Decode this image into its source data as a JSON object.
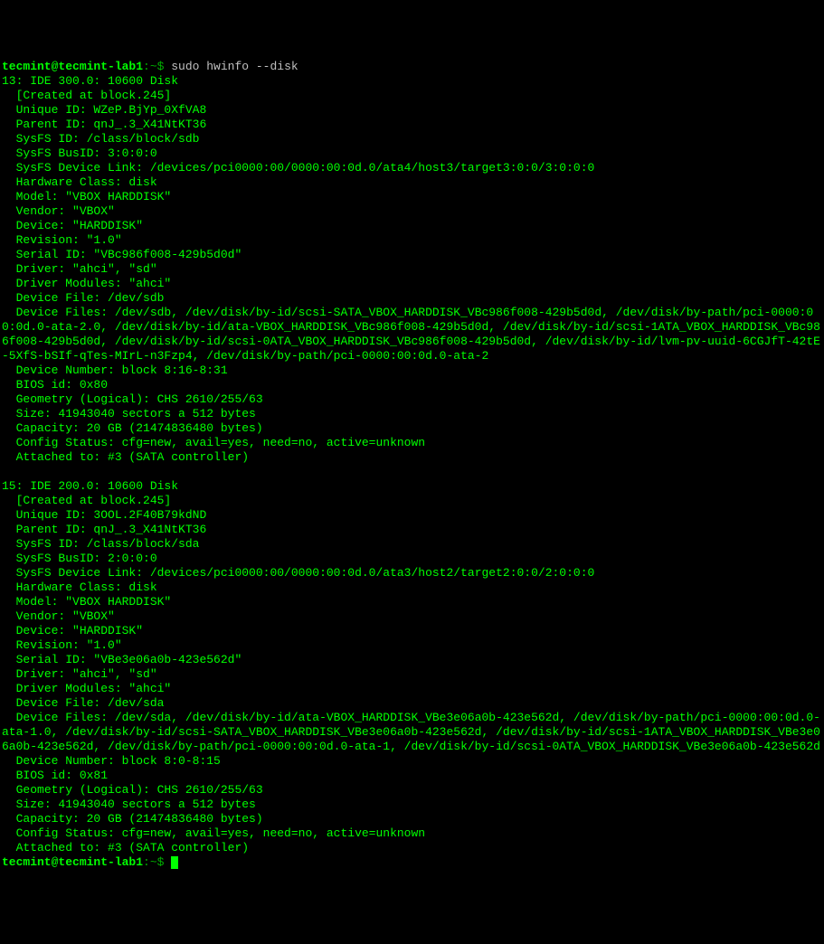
{
  "prompt1": {
    "user_host": "tecmint@tecmint-lab1",
    "sep_path": ":~$ ",
    "command": "sudo hwinfo --disk"
  },
  "disk1": {
    "header": "13: IDE 300.0: 10600 Disk",
    "created": "  [Created at block.245]",
    "unique_id": "  Unique ID: WZeP.BjYp_0XfVA8",
    "parent_id": "  Parent ID: qnJ_.3_X41NtKT36",
    "sysfs_id": "  SysFS ID: /class/block/sdb",
    "sysfs_busid": "  SysFS BusID: 3:0:0:0",
    "sysfs_devlink": "  SysFS Device Link: /devices/pci0000:00/0000:00:0d.0/ata4/host3/target3:0:0/3:0:0:0",
    "hw_class": "  Hardware Class: disk",
    "model": "  Model: \"VBOX HARDDISK\"",
    "vendor": "  Vendor: \"VBOX\"",
    "device": "  Device: \"HARDDISK\"",
    "revision": "  Revision: \"1.0\"",
    "serial": "  Serial ID: \"VBc986f008-429b5d0d\"",
    "driver": "  Driver: \"ahci\", \"sd\"",
    "driver_modules": "  Driver Modules: \"ahci\"",
    "device_file": "  Device File: /dev/sdb",
    "device_files": "  Device Files: /dev/sdb, /dev/disk/by-id/scsi-SATA_VBOX_HARDDISK_VBc986f008-429b5d0d, /dev/disk/by-path/pci-0000:00:0d.0-ata-2.0, /dev/disk/by-id/ata-VBOX_HARDDISK_VBc986f008-429b5d0d, /dev/disk/by-id/scsi-1ATA_VBOX_HARDDISK_VBc986f008-429b5d0d, /dev/disk/by-id/scsi-0ATA_VBOX_HARDDISK_VBc986f008-429b5d0d, /dev/disk/by-id/lvm-pv-uuid-6CGJfT-42tE-5XfS-bSIf-qTes-MIrL-n3Fzp4, /dev/disk/by-path/pci-0000:00:0d.0-ata-2",
    "device_number": "  Device Number: block 8:16-8:31",
    "bios_id": "  BIOS id: 0x80",
    "geometry": "  Geometry (Logical): CHS 2610/255/63",
    "size": "  Size: 41943040 sectors a 512 bytes",
    "capacity": "  Capacity: 20 GB (21474836480 bytes)",
    "config_status": "  Config Status: cfg=new, avail=yes, need=no, active=unknown",
    "attached": "  Attached to: #3 (SATA controller)"
  },
  "disk2": {
    "header": "15: IDE 200.0: 10600 Disk",
    "created": "  [Created at block.245]",
    "unique_id": "  Unique ID: 3OOL.2F40B79kdND",
    "parent_id": "  Parent ID: qnJ_.3_X41NtKT36",
    "sysfs_id": "  SysFS ID: /class/block/sda",
    "sysfs_busid": "  SysFS BusID: 2:0:0:0",
    "sysfs_devlink": "  SysFS Device Link: /devices/pci0000:00/0000:00:0d.0/ata3/host2/target2:0:0/2:0:0:0",
    "hw_class": "  Hardware Class: disk",
    "model": "  Model: \"VBOX HARDDISK\"",
    "vendor": "  Vendor: \"VBOX\"",
    "device": "  Device: \"HARDDISK\"",
    "revision": "  Revision: \"1.0\"",
    "serial": "  Serial ID: \"VBe3e06a0b-423e562d\"",
    "driver": "  Driver: \"ahci\", \"sd\"",
    "driver_modules": "  Driver Modules: \"ahci\"",
    "device_file": "  Device File: /dev/sda",
    "device_files": "  Device Files: /dev/sda, /dev/disk/by-id/ata-VBOX_HARDDISK_VBe3e06a0b-423e562d, /dev/disk/by-path/pci-0000:00:0d.0-ata-1.0, /dev/disk/by-id/scsi-SATA_VBOX_HARDDISK_VBe3e06a0b-423e562d, /dev/disk/by-id/scsi-1ATA_VBOX_HARDDISK_VBe3e06a0b-423e562d, /dev/disk/by-path/pci-0000:00:0d.0-ata-1, /dev/disk/by-id/scsi-0ATA_VBOX_HARDDISK_VBe3e06a0b-423e562d",
    "device_number": "  Device Number: block 8:0-8:15",
    "bios_id": "  BIOS id: 0x81",
    "geometry": "  Geometry (Logical): CHS 2610/255/63",
    "size": "  Size: 41943040 sectors a 512 bytes",
    "capacity": "  Capacity: 20 GB (21474836480 bytes)",
    "config_status": "  Config Status: cfg=new, avail=yes, need=no, active=unknown",
    "attached": "  Attached to: #3 (SATA controller)"
  },
  "prompt2": {
    "user_host": "tecmint@tecmint-lab1",
    "sep_path": ":~$ "
  }
}
